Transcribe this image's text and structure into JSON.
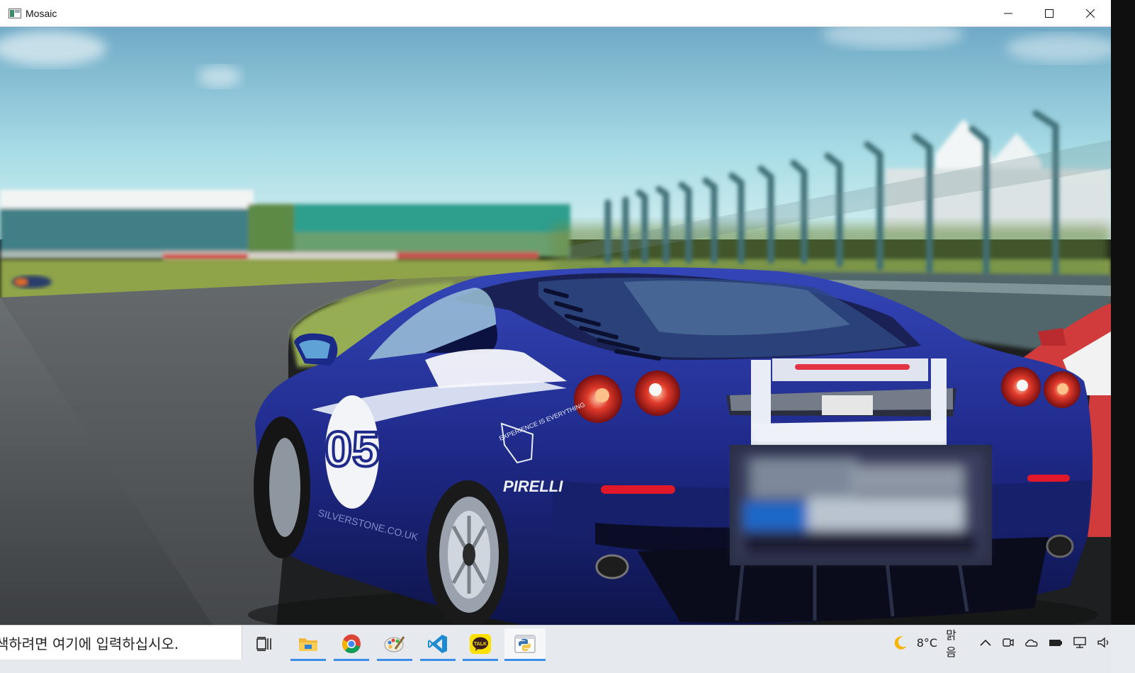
{
  "window": {
    "title": "Mosaic",
    "controls": [
      "minimize",
      "maximize",
      "close"
    ]
  },
  "image": {
    "content": "photo",
    "mosaic_region": "license-plate"
  },
  "car_text": {
    "number": "05",
    "sponsor": "PIRELLI",
    "door_text": "SILVERSTONE.CO.UK",
    "badge": "EXPERIENCE IS EVERYTHING"
  },
  "taskbar": {
    "search_text": "색하려면 여기에 입력하십시오.",
    "apps": [
      "task-view",
      "file-explorer",
      "chrome",
      "paint",
      "vscode",
      "kakaotalk",
      "python"
    ],
    "weather": {
      "temperature": "8°C",
      "condition": "맑음",
      "icon": "moon-icon"
    },
    "tray_icons": [
      "chevron-up-icon",
      "meet-now-icon",
      "onedrive-icon",
      "battery-icon",
      "network-icon",
      "volume-icon"
    ]
  },
  "colors": {
    "accent": "#3b8ee8",
    "car_blue": "#1f2a8a",
    "sky": "#8fc7d8"
  }
}
